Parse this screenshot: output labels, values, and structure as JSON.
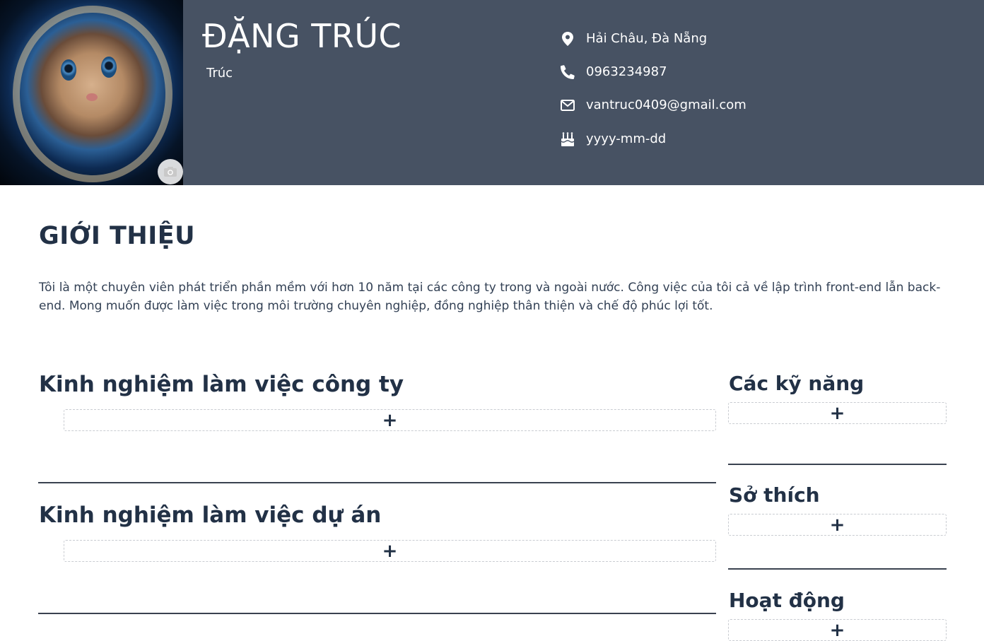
{
  "profile": {
    "name": "ĐẶNG TRÚC",
    "nickname": "Trúc",
    "address": "Hải Châu, Đà Nẵng",
    "phone": "0963234987",
    "email": "vantruc0409@gmail.com",
    "birthday": "yyyy-mm-dd",
    "avatar_icon": "camera-icon"
  },
  "intro": {
    "title": "GIỚI THIỆU",
    "text": "Tôi là một chuyên viên phát triển phần mềm với hơn 10 năm tại các công ty trong và ngoài nước. Công việc của tôi cả về lập trình front-end lẫn back-end. Mong muốn được làm việc trong môi trường chuyên nghiệp, đồng nghiệp thân thiện và chế độ phúc lợi tốt."
  },
  "sections": {
    "company_experience": {
      "title": "Kinh nghiệm làm việc công ty",
      "add_label": "+"
    },
    "project_experience": {
      "title": "Kinh nghiệm làm việc dự án",
      "add_label": "+"
    },
    "skills": {
      "title": "Các kỹ năng",
      "add_label": "+"
    },
    "hobbies": {
      "title": "Sở thích",
      "add_label": "+"
    },
    "activities": {
      "title": "Hoạt động",
      "add_label": "+"
    }
  },
  "colors": {
    "header_bg": "#475263",
    "heading": "#223146",
    "divider": "#3a4250"
  }
}
